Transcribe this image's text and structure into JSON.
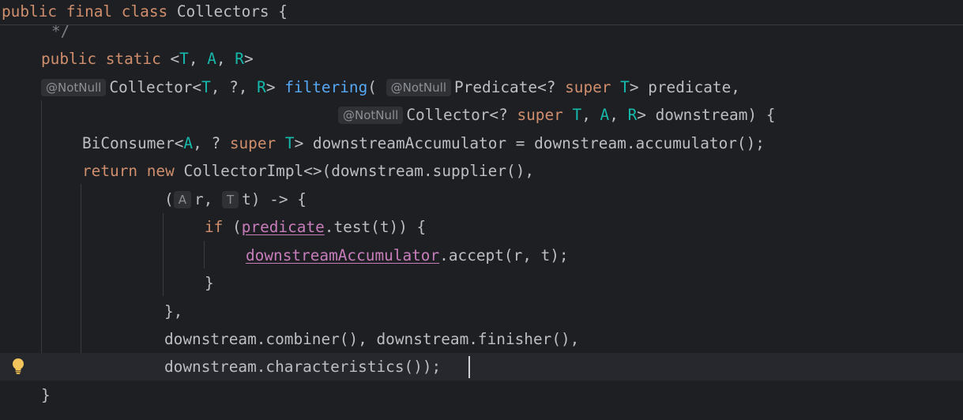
{
  "editor": {
    "sticky_header": {
      "kw_public": "public",
      "kw_final": "final",
      "kw_class": "class",
      "class_name": "Collectors",
      "brace": "{"
    },
    "comment_end": "*/",
    "line_method_sig": {
      "kw_public": "public",
      "kw_static": "static",
      "lt": "<",
      "tp_T": "T",
      "sep1": ", ",
      "tp_A": "A",
      "sep2": ", ",
      "tp_R": "R",
      "gt": ">"
    },
    "line_filtering": {
      "hint": "@NotNull",
      "ret1": "Collector<",
      "tp_T": "T",
      "ret2": ", ?, ",
      "tp_R": "R",
      "ret3": "> ",
      "fn_name": "filtering",
      "paren": "(",
      "hint2": "@NotNull",
      "p1": "Predicate<? ",
      "kw_super": "super",
      "p2": " ",
      "tp_T2": "T",
      "p3": "> predicate,"
    },
    "line_downstream_param": {
      "hint": "@NotNull",
      "p1": "Collector<? ",
      "kw_super": "super",
      "p2": " ",
      "tp_T": "T",
      "p3": ", ",
      "tp_A": "A",
      "p4": ", ",
      "tp_R": "R",
      "p5": "> downstream) {"
    },
    "line_biconsumer": {
      "p1": "BiConsumer<",
      "tp_A": "A",
      "p2": ", ? ",
      "kw_super": "super",
      "p3": " ",
      "tp_T": "T",
      "p4": "> downstreamAccumulator = downstream.accumulator();"
    },
    "line_return": {
      "kw_return": "return",
      "p1": " ",
      "kw_new": "new",
      "p2": " CollectorImpl<>(downstream.supplier(),"
    },
    "line_lambda": {
      "p1": "(",
      "hint_A": "A",
      "p2": "r, ",
      "hint_T": "T",
      "p3": "t) -> {"
    },
    "line_if": {
      "kw_if": "if",
      "p1": " (",
      "field": "predicate",
      "p2": ".test(t)) {"
    },
    "line_accept": {
      "field": "downstreamAccumulator",
      "p1": ".accept(r, t);"
    },
    "line_close_if": "}",
    "line_close_lambda": "},",
    "line_combiner": "downstream.combiner(), downstream.finisher(),",
    "line_characteristics": "downstream.characteristics());",
    "line_close_method": "}"
  },
  "icons": {
    "intention": "lightbulb-icon"
  },
  "colors": {
    "background": "#1e1f22",
    "keyword": "#cf8e6d",
    "type_param": "#16baac",
    "method_decl": "#56a8f5",
    "field": "#c77dbb",
    "text": "#bcbec4",
    "hint": "#8c8f94"
  }
}
